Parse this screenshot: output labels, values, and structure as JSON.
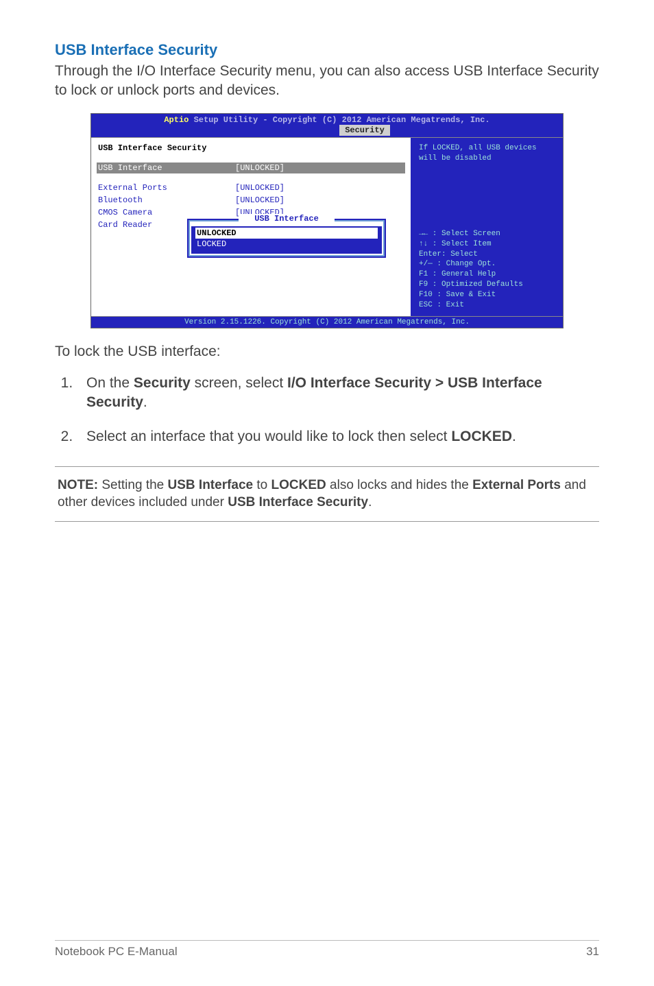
{
  "section": {
    "title": "USB Interface Security",
    "intro": "Through the I/O Interface Security menu, you can also access USB Interface Security to lock or unlock ports and devices."
  },
  "bios": {
    "header_prefix": "Aptio ",
    "header_rest": "Setup Utility - Copyright (C) 2012 American Megatrends, Inc.",
    "tab": "Security",
    "left_title": "USB Interface Security",
    "rows": [
      {
        "label": "USB Interface",
        "value": "[UNLOCKED]"
      },
      {
        "label": "External Ports",
        "value": "[UNLOCKED]"
      },
      {
        "label": "Bluetooth",
        "value": "[UNLOCKED]"
      },
      {
        "label": "CMOS Camera",
        "value": "[UNLOCKED]"
      },
      {
        "label": "Card Reader",
        "value": ""
      }
    ],
    "popup": {
      "title": "USB Interface",
      "options": [
        "UNLOCKED",
        "LOCKED"
      ],
      "selected_index": 0
    },
    "right_hint": "If LOCKED, all USB devices will be disabled",
    "help": [
      "→←   : Select Screen",
      "↑↓   : Select Item",
      "Enter: Select",
      "+/—  : Change Opt.",
      "F1   : General Help",
      "F9   : Optimized Defaults",
      "F10  : Save & Exit",
      "ESC  : Exit"
    ],
    "footer": "Version 2.15.1226. Copyright (C) 2012 American Megatrends, Inc."
  },
  "after_bios": "To lock the USB interface:",
  "steps": {
    "s1_a": "On the ",
    "s1_b": "Security",
    "s1_c": " screen, select ",
    "s1_d": "I/O Interface Security > USB Interface Security",
    "s1_e": ".",
    "s2_a": "Select an interface that you would like to lock then select ",
    "s2_b": "LOCKED",
    "s2_c": "."
  },
  "note": {
    "a": "NOTE:",
    "b": " Setting the ",
    "c": "USB Interface",
    "d": " to ",
    "e": "LOCKED",
    "f": " also locks and hides the ",
    "g": "External Ports",
    "h": " and other devices included under ",
    "i": "USB Interface Security",
    "j": "."
  },
  "footer": {
    "left": "Notebook PC E-Manual",
    "right": "31"
  }
}
